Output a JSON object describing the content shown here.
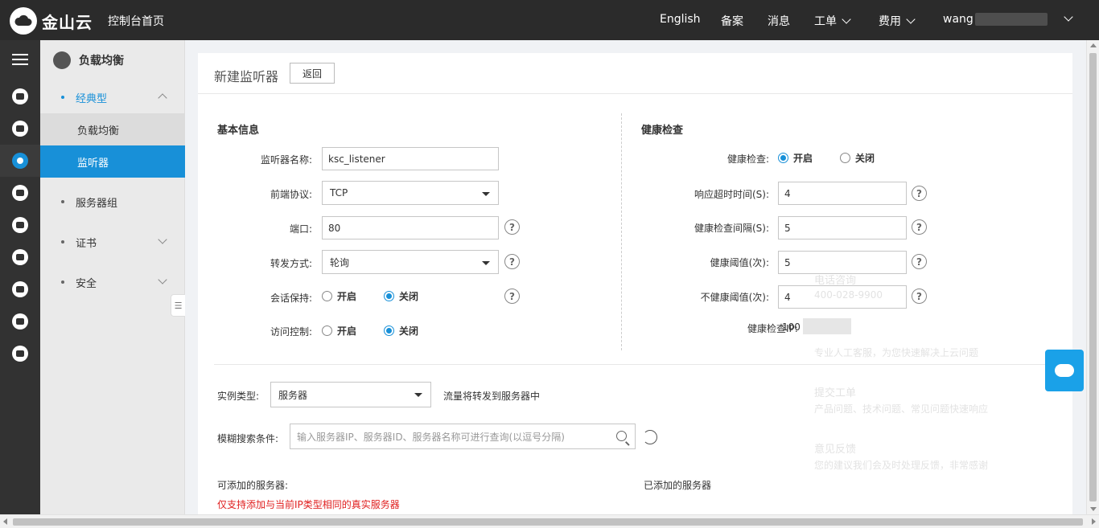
{
  "topbar": {
    "logo_text": "金山云",
    "console_home": "控制台首页",
    "english": "English",
    "filing": "备案",
    "messages": "消息",
    "tickets": "工单",
    "billing": "费用",
    "user": "wang"
  },
  "icons": {
    "menu": "menu-icon",
    "cloud_logo": "cloud-logo-icon"
  },
  "sidenav": {
    "product": "负载均衡",
    "classic": "经典型",
    "load_balance": "负载均衡",
    "listener": "监听器",
    "server_group": "服务器组",
    "certificate": "证书",
    "security": "安全"
  },
  "panel": {
    "title": "新建监听器",
    "back": "返回"
  },
  "basic": {
    "section": "基本信息",
    "name_label": "监听器名称:",
    "name_value": "ksc_listener",
    "protocol_label": "前端协议:",
    "protocol_value": "TCP",
    "port_label": "端口:",
    "port_value": "80",
    "forward_label": "转发方式:",
    "forward_value": "轮询",
    "session_label": "会话保持:",
    "access_label": "访问控制:",
    "on": "开启",
    "off": "关闭",
    "help": "?"
  },
  "health": {
    "section": "健康检查",
    "check_label": "健康检查:",
    "on": "开启",
    "off": "关闭",
    "timeout_label": "响应超时时间(S):",
    "timeout_value": "4",
    "interval_label": "健康检查间隔(S):",
    "interval_value": "5",
    "healthy_label": "健康阈值(次):",
    "healthy_value": "5",
    "unhealthy_label": "不健康阈值(次):",
    "unhealthy_value": "4",
    "ip_label": "健康检查IP:",
    "ip_value": "100"
  },
  "instance": {
    "type_label": "实例类型:",
    "type_value": "服务器",
    "type_hint": "流量将转发到服务器中",
    "search_label": "模糊搜索条件:",
    "search_placeholder": "输入服务器IP、服务器ID、服务器名称可进行查询(以逗号分隔)",
    "available": "可添加的服务器:",
    "added": "已添加的服务器",
    "warning": "仅支持添加与当前IP类型相同的真实服务器"
  },
  "ghost": {
    "phone_title": "电话咨询",
    "phone_number": "400-028-9900",
    "service_desc": "专业人工客服，为您快速解决上云问题",
    "ticket_title": "提交工单",
    "ticket_desc": "产品问题、技术问题、常见问题快速响应",
    "feedback_title": "意见反馈",
    "feedback_desc": "您的建议我们会及时处理反馈，非常感谢"
  },
  "colors": {
    "topbar": "#2b2b2b",
    "accent": "#1890d8",
    "warning": "#e02020"
  }
}
